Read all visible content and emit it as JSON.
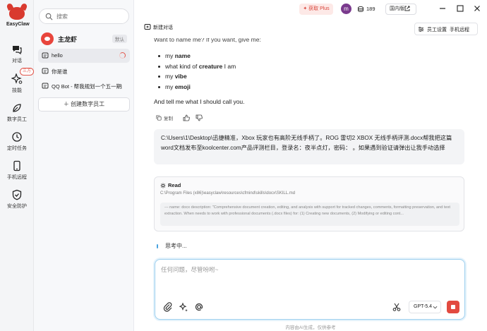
{
  "brand": {
    "name": "EasyClaw"
  },
  "rail": {
    "items": [
      {
        "label": "对话",
        "icon": "chat-icon"
      },
      {
        "label": "技能",
        "icon": "sparkle-icon",
        "badge": "三方"
      },
      {
        "label": "数字员工",
        "icon": "leaf-icon"
      },
      {
        "label": "定时任务",
        "icon": "clock-icon"
      },
      {
        "label": "手机远程",
        "icon": "phone-icon"
      },
      {
        "label": "安全防护",
        "icon": "shield-icon"
      }
    ]
  },
  "sidebar": {
    "search_placeholder": "搜索",
    "agent": {
      "name": "主龙虾",
      "tag": "默认"
    },
    "chats": [
      {
        "title": "hello",
        "active": true,
        "loading": true
      },
      {
        "title": "你是谁"
      },
      {
        "title": "QQ Bot - 帮我规划一个五一期间..."
      }
    ],
    "create_label": "创建数字员工"
  },
  "topbar": {
    "new_chat": "新建对话",
    "plus_label": "获取 Plus",
    "avatar_letter": "m",
    "credits": "189",
    "region": "国内版",
    "staff_settings": "员工设置",
    "phone_remote": "手机远程"
  },
  "assistant": {
    "cut_line": "Want to name me? If you want, give me:",
    "items": [
      {
        "pre": "my ",
        "bold": "name",
        "post": ""
      },
      {
        "pre": "what kind of ",
        "bold": "creature",
        "post": " I am"
      },
      {
        "pre": "my ",
        "bold": "vibe",
        "post": ""
      },
      {
        "pre": "my ",
        "bold": "emoji",
        "post": ""
      }
    ],
    "closing": "And tell me what I should call you.",
    "copy_label": "复制"
  },
  "user_message": "C:\\Users\\1\\Desktop\\迅捷精准，Xbox 玩家也有高阶无线手柄了。ROG 雷切2 XBOX 无线手柄评测.docx帮我把这篇word文档发布至koolcenter.com产品评测栏目，登录名：夜半点灯，密码：                。如果遇到验证请弹出让我手动选择",
  "tool_call": {
    "name": "Read",
    "path": "C:\\Program Files (x86)\\easyclaw\\resources\\cfmind\\skills\\docx\\SKILL.md",
    "description": "--- name: docx description: \"Comprehensive document creation, editing, and analysis with support for tracked changes, comments, formatting preservation, and text extraction. When needs to work with professional documents (.docx files) for: (1) Creating new documents, (2) Modifying or editing cont..."
  },
  "status": {
    "thinking": "思考中..."
  },
  "composer": {
    "placeholder": "任何问题，尽管吩咐~",
    "model": "GPT-5.4"
  },
  "footer": {
    "note": "内容由AI生成，仅供参考"
  },
  "colors": {
    "accent": "#e24a40",
    "focus": "#9fd0ef"
  }
}
